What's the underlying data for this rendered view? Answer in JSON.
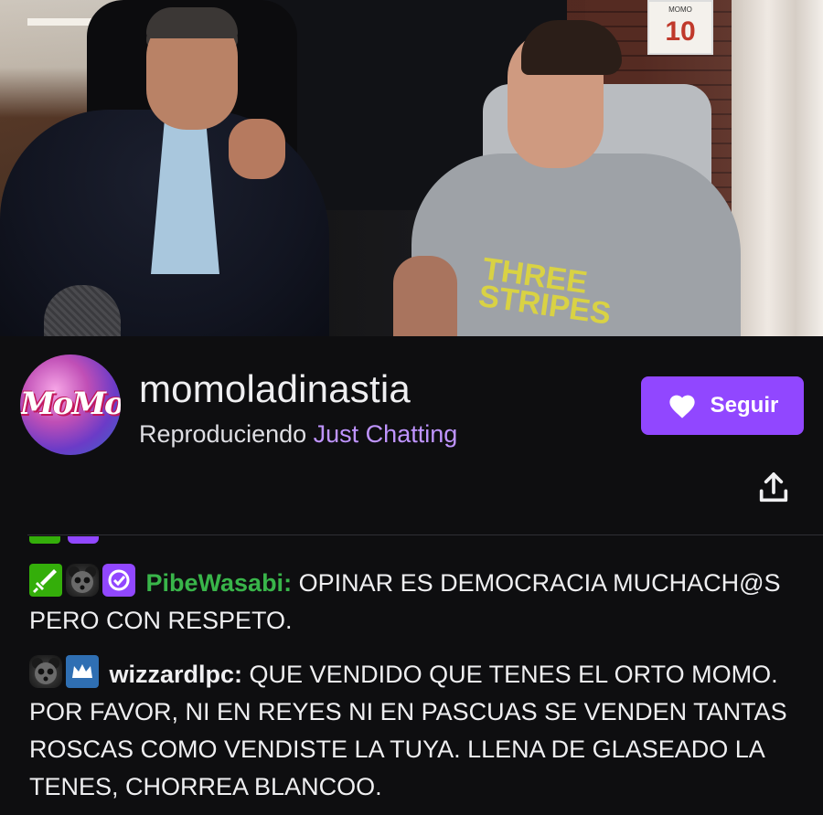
{
  "channel": {
    "name": "momoladinastia",
    "playing_prefix": "Reproduciendo",
    "category": "Just Chatting",
    "avatar_monogram": "MoMo",
    "follow_label": "Seguir",
    "share_icon": "share-icon",
    "follow_icon": "heart-icon"
  },
  "video": {
    "frame_label": "MOMO",
    "frame_number": "10",
    "shirt_text": "THREE STRIPES"
  },
  "chat": {
    "messages": [
      {
        "badges": [
          "moderator-sword-badge",
          "panda-emote-badge",
          "verified-badge"
        ],
        "username": "PibeWasabi",
        "text": "OPINAR ES DEMOCRACIA MUCHACH@S PERO CON RESPETO."
      },
      {
        "badges": [
          "panda-emote-badge",
          "crown-sub-badge"
        ],
        "username": "wizzardlpc",
        "text": "QUE VENDIDO QUE TENES EL ORTO MOMO. POR FAVOR, NI EN REYES NI EN PASCUAS SE VENDEN TANTAS ROSCAS COMO VENDISTE LA TUYA. LLENA DE GLASEADO LA TENES, CHORREA BLANCOO."
      }
    ]
  },
  "colors": {
    "accent": "#9147ff",
    "category": "#bf94ff",
    "background": "#0e0e10",
    "mod_badge": "#34ae0a",
    "username_green": "#39b54a"
  }
}
